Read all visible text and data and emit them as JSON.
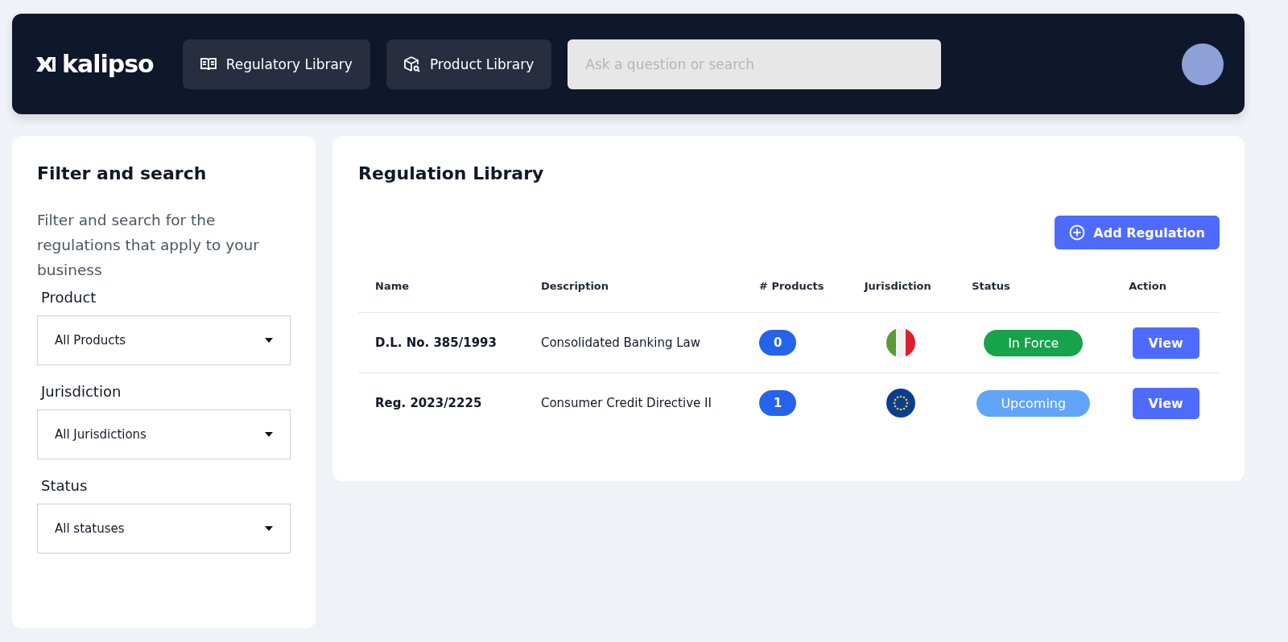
{
  "header": {
    "logo": "kalipso",
    "nav": [
      {
        "label": "Regulatory Library",
        "kind": "book"
      },
      {
        "label": "Product Library",
        "kind": "box"
      }
    ],
    "search": {
      "placeholder": "Ask a question or search"
    }
  },
  "sidebar": {
    "title": "Filter and search",
    "description": "Filter and search for the regulations that apply to your business",
    "filters": [
      {
        "label": "Product",
        "value": "All Products"
      },
      {
        "label": "Jurisdiction",
        "value": "All Jurisdictions"
      },
      {
        "label": "Status",
        "value": "All statuses"
      }
    ]
  },
  "library": {
    "title": "Regulation Library",
    "add_button": "Add Regulation",
    "columns": [
      "Name",
      "Description",
      "# Products",
      "Jurisdiction",
      "Status",
      "Action"
    ],
    "rows": [
      {
        "name": "D.L. No. 385/1993",
        "description": "Consolidated Banking Law",
        "products": "0",
        "kind": "italy",
        "status": {
          "label": "In Force",
          "kind": "in_force"
        },
        "action": "View"
      },
      {
        "name": "Reg. 2023/2225",
        "description": "Consumer Credit Directive II",
        "products": "1",
        "kind": "eu",
        "status": {
          "label": "Upcoming",
          "kind": "upcoming"
        },
        "action": "View"
      }
    ]
  }
}
